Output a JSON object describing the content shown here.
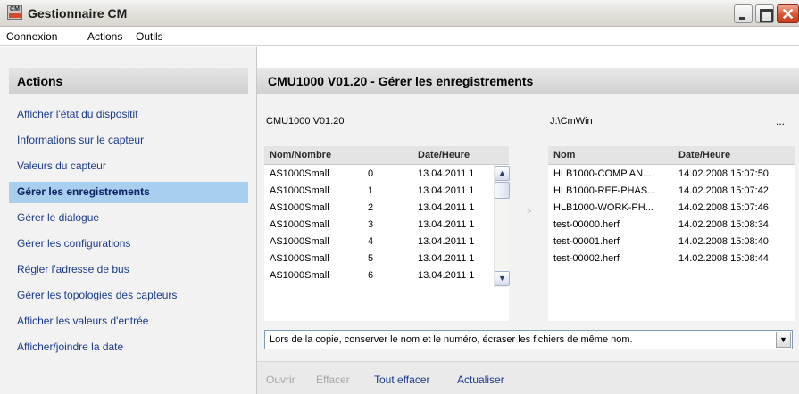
{
  "window": {
    "title": "Gestionnaire CM",
    "icon_label": "CM",
    "min_icon": "minimize-icon",
    "max_icon": "maximize-icon",
    "close_glyph": "✕"
  },
  "menu": [
    "Connexion",
    "Actions",
    "Outils"
  ],
  "left": {
    "header": "Actions",
    "items": [
      "Afficher l'état du dispositif",
      "Informations sur le capteur",
      "Valeurs du capteur",
      "Gérer les enregistrements",
      "Gérer le dialogue",
      "Gérer les configurations",
      "Régler l'adresse de bus",
      "Gérer les topologies des capteurs",
      "Afficher les valeurs d'entrée",
      "Afficher/joindre la date"
    ],
    "active_index": 3
  },
  "main": {
    "header": "CMU1000 V01.20 - Gérer les enregistrements",
    "device_label": "CMU1000 V01.20",
    "path_label": "J:\\CmWin",
    "path_button": "...",
    "device_list": {
      "col_name": "Nom/Nombre",
      "col_date": "Date/Heure",
      "rows": [
        {
          "name": "AS1000Small",
          "num": "0",
          "date": "13.04.2011 1"
        },
        {
          "name": "AS1000Small",
          "num": "1",
          "date": "13.04.2011 1"
        },
        {
          "name": "AS1000Small",
          "num": "2",
          "date": "13.04.2011 1"
        },
        {
          "name": "AS1000Small",
          "num": "3",
          "date": "13.04.2011 1"
        },
        {
          "name": "AS1000Small",
          "num": "4",
          "date": "13.04.2011 1"
        },
        {
          "name": "AS1000Small",
          "num": "5",
          "date": "13.04.2011 1"
        },
        {
          "name": "AS1000Small",
          "num": "6",
          "date": "13.04.2011 1"
        }
      ]
    },
    "transfer_arrow": ">",
    "pc_list": {
      "col_name": "Nom",
      "col_date": "Date/Heure",
      "rows": [
        {
          "name": "HLB1000-COMP AN...",
          "date": "14.02.2008 15:07:50"
        },
        {
          "name": "HLB1000-REF-PHAS...",
          "date": "14.02.2008 15:07:42"
        },
        {
          "name": "HLB1000-WORK-PH...",
          "date": "14.02.2008 15:07:46"
        },
        {
          "name": "test-00000.herf",
          "date": "14.02.2008 15:08:34"
        },
        {
          "name": "test-00001.herf",
          "date": "14.02.2008 15:08:40"
        },
        {
          "name": "test-00002.herf",
          "date": "14.02.2008 15:08:44"
        }
      ]
    },
    "copy_mode": "Lors de la copie, conserver le nom et le numéro, écraser les fichiers de même nom.",
    "actions": {
      "open": "Ouvrir",
      "delete": "Effacer",
      "delete_all": "Tout effacer",
      "refresh": "Actualiser"
    }
  }
}
